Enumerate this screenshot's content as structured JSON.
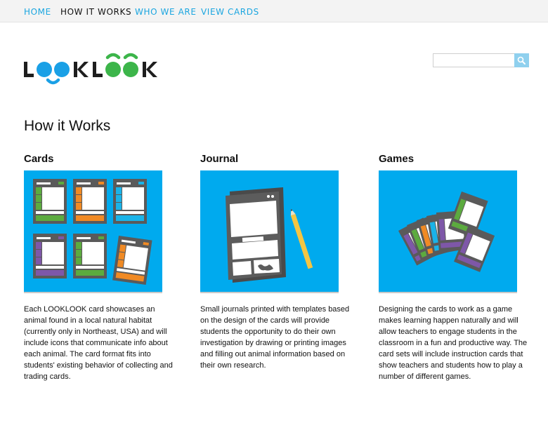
{
  "nav": {
    "items": [
      {
        "label": "HOME",
        "active": false
      },
      {
        "label": "HOW IT WORKS",
        "active": true
      },
      {
        "label": "WHO WE ARE",
        "active": false
      },
      {
        "label": "VIEW CARDS",
        "active": false
      }
    ],
    "link_color": "#1ba6e0",
    "active_color": "#111111"
  },
  "logo": {
    "text": "LOOKLOOK",
    "colors": {
      "dark": "#1e1e1e",
      "blue": "#1aa0e6",
      "green": "#3cb54a"
    }
  },
  "search": {
    "placeholder": "",
    "button_icon": "search-icon"
  },
  "page": {
    "title": "How it Works"
  },
  "sections": [
    {
      "heading": "Cards",
      "image_icon": "animal-cards-illustration",
      "text": "Each LOOKLOOK card showcases an animal found in a local natural habitat (currently only in Northeast, USA) and will include icons that communicate info about each animal. The card format fits into students' existing behavior of collecting and trading cards."
    },
    {
      "heading": "Journal",
      "image_icon": "journal-pencil-illustration",
      "text": "Small journals printed with templates based on the design of the cards will provide students the opportunity to do their own investigation by drawing or printing images and filling out animal information based on their own research."
    },
    {
      "heading": "Games",
      "image_icon": "fanned-cards-illustration",
      "text": "Designing the cards to work as a game makes learning happen naturally and will allow teachers to engage students in the classroom in a fun and productive way. The card sets will include instruction cards that show teachers and students how to play a number of different games."
    }
  ],
  "colors": {
    "illustration_bg": "#00aaee",
    "card_gray": "#555555",
    "green": "#5cab3f",
    "orange": "#f08a24",
    "blue": "#1ab3e8",
    "purple": "#7e57a8"
  }
}
